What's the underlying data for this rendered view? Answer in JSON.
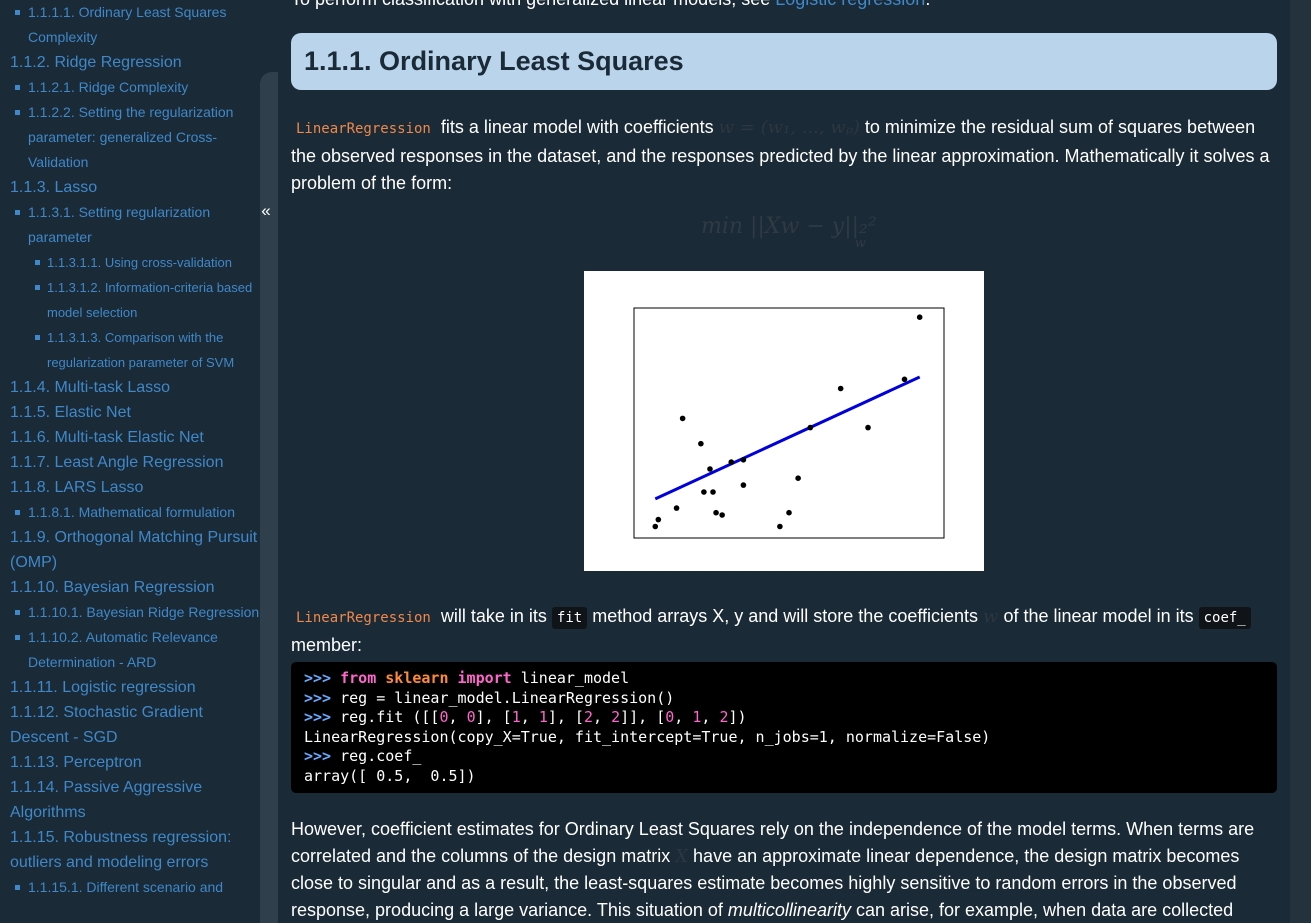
{
  "sidebar": {
    "items": [
      {
        "level": 2,
        "label": "1.1.1.1. Ordinary Least Squares Complexity"
      },
      {
        "level": 1,
        "label": "1.1.2. Ridge Regression"
      },
      {
        "level": 2,
        "label": "1.1.2.1. Ridge Complexity"
      },
      {
        "level": 2,
        "label": "1.1.2.2. Setting the regularization parameter: generalized Cross-Validation"
      },
      {
        "level": 1,
        "label": "1.1.3. Lasso"
      },
      {
        "level": 2,
        "label": "1.1.3.1. Setting regularization parameter"
      },
      {
        "level": 3,
        "label": "1.1.3.1.1. Using cross-validation"
      },
      {
        "level": 3,
        "label": "1.1.3.1.2. Information-criteria based model selection"
      },
      {
        "level": 3,
        "label": "1.1.3.1.3. Comparison with the regularization parameter of SVM"
      },
      {
        "level": 1,
        "label": "1.1.4. Multi-task Lasso"
      },
      {
        "level": 1,
        "label": "1.1.5. Elastic Net"
      },
      {
        "level": 1,
        "label": "1.1.6. Multi-task Elastic Net"
      },
      {
        "level": 1,
        "label": "1.1.7. Least Angle Regression"
      },
      {
        "level": 1,
        "label": "1.1.8. LARS Lasso"
      },
      {
        "level": 2,
        "label": "1.1.8.1. Mathematical formulation"
      },
      {
        "level": 1,
        "label": "1.1.9. Orthogonal Matching Pursuit (OMP)"
      },
      {
        "level": 1,
        "label": "1.1.10. Bayesian Regression"
      },
      {
        "level": 2,
        "label": "1.1.10.1. Bayesian Ridge Regression"
      },
      {
        "level": 2,
        "label": "1.1.10.2. Automatic Relevance Determination - ARD"
      },
      {
        "level": 1,
        "label": "1.1.11. Logistic regression"
      },
      {
        "level": 1,
        "label": "1.1.12. Stochastic Gradient Descent - SGD"
      },
      {
        "level": 1,
        "label": "1.1.13. Perceptron"
      },
      {
        "level": 1,
        "label": "1.1.14. Passive Aggressive Algorithms"
      },
      {
        "level": 1,
        "label": "1.1.15. Robustness regression: outliers and modeling errors"
      },
      {
        "level": 2,
        "label": "1.1.15.1. Different scenario and"
      }
    ],
    "collapse_glyph": "«"
  },
  "content": {
    "top_text": "To perform classification with generalized linear models, see ",
    "top_link": "Logistic regression",
    "top_end": ".",
    "heading": "1.1.1. Ordinary Least Squares",
    "p1": {
      "code": "LinearRegression",
      "t1": " fits a linear model with coefficients ",
      "math": "w = (w₁, ..., wₚ)",
      "t2": " to minimize the residual sum of squares between the observed responses in the dataset, and the responses predicted by the linear approximation. Mathematically it solves a problem of the form:"
    },
    "formula": "min ||Xw − y||₂²",
    "formula_sub": "w",
    "p2": {
      "code": "LinearRegression",
      "t1": " will take in its ",
      "fit": "fit",
      "t2": " method arrays X, y and will store the coefficients ",
      "math": "w",
      "t3": " of the linear model in its ",
      "coef": "coef_",
      "t4": " member:"
    },
    "code_lines": {
      "l1_prompt": ">>> ",
      "l1_from": "from",
      "l1_mod": "sklearn",
      "l1_import": "import",
      "l1_rest": " linear_model",
      "l2_prompt": ">>> ",
      "l2_rest": "reg = linear_model.LinearRegression()",
      "l3_prompt": ">>> ",
      "l3_a": "reg.fit ([[",
      "l3_n1": "0",
      "l3_b": ", ",
      "l3_n2": "0",
      "l3_c": "], [",
      "l3_n3": "1",
      "l3_d": ", ",
      "l3_n4": "1",
      "l3_e": "], [",
      "l3_n5": "2",
      "l3_f": ", ",
      "l3_n6": "2",
      "l3_g": "]], [",
      "l3_n7": "0",
      "l3_h": ", ",
      "l3_n8": "1",
      "l3_i": ", ",
      "l3_n9": "2",
      "l3_j": "])",
      "l4": "LinearRegression(copy_X=True, fit_intercept=True, n_jobs=1, normalize=False)",
      "l5_prompt": ">>> ",
      "l5_rest": "reg.coef_",
      "l6": "array([ 0.5,  0.5])"
    },
    "p3": {
      "t1": "However, coefficient estimates for Ordinary Least Squares rely on the independence of the model terms. When terms are correlated and the columns of the design matrix ",
      "math": "X",
      "t2": " have an approximate linear dependence, the design matrix becomes close to singular and as a result, the least-squares estimate becomes highly sensitive to random errors in the observed response, producing a large variance. This situation of ",
      "em": "multicollinearity",
      "t3": " can arise, for example, when data are collected"
    }
  },
  "chart_data": {
    "type": "scatter",
    "x": [
      0.05,
      0.06,
      0.12,
      0.14,
      0.2,
      0.21,
      0.23,
      0.24,
      0.25,
      0.27,
      0.3,
      0.34,
      0.34,
      0.46,
      0.49,
      0.52,
      0.56,
      0.66,
      0.75,
      0.87,
      0.92
    ],
    "y": [
      0.05,
      0.08,
      0.13,
      0.52,
      0.41,
      0.2,
      0.3,
      0.2,
      0.11,
      0.1,
      0.33,
      0.23,
      0.34,
      0.05,
      0.11,
      0.26,
      0.48,
      0.65,
      0.48,
      0.69,
      0.96
    ],
    "fit_line": {
      "x": [
        0.05,
        0.92
      ],
      "y": [
        0.17,
        0.7
      ]
    },
    "point_color": "#000000",
    "line_color": "#0000dd",
    "xlim": [
      -0.02,
      1.0
    ],
    "ylim": [
      0.0,
      1.0
    ],
    "ticks": "none"
  }
}
